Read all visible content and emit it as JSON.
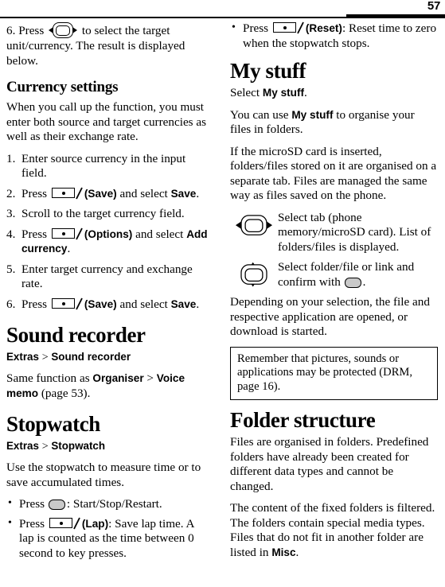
{
  "header": {
    "page_number": "57"
  },
  "left_column": {
    "continued_step": {
      "number": "6.",
      "text_before": "Press",
      "icon": "nav-key-left-right-icon",
      "text_after": "to select the target unit/currency. The result is displayed below."
    },
    "currency_settings": {
      "heading": "Currency settings",
      "intro": "When you call up the function, you must enter both source and target currencies as well as their exchange rate.",
      "steps": [
        {
          "num": 1,
          "parts": [
            {
              "type": "text",
              "value": "Enter source currency in the input field."
            }
          ]
        },
        {
          "num": 2,
          "parts": [
            {
              "type": "text",
              "value": "Press "
            },
            {
              "type": "icon",
              "value": "softkey-icon"
            },
            {
              "type": "ui",
              "value": "(Save)"
            },
            {
              "type": "text",
              "value": " and select "
            },
            {
              "type": "ui",
              "value": "Save"
            },
            {
              "type": "text",
              "value": "."
            }
          ]
        },
        {
          "num": 3,
          "parts": [
            {
              "type": "text",
              "value": "Scroll to the target currency field."
            }
          ]
        },
        {
          "num": 4,
          "parts": [
            {
              "type": "text",
              "value": "Press "
            },
            {
              "type": "icon",
              "value": "softkey-icon"
            },
            {
              "type": "ui",
              "value": "(Options)"
            },
            {
              "type": "text",
              "value": " and select "
            },
            {
              "type": "ui",
              "value": "Add currency"
            },
            {
              "type": "text",
              "value": "."
            }
          ]
        },
        {
          "num": 5,
          "parts": [
            {
              "type": "text",
              "value": "Enter target currency and exchange rate."
            }
          ]
        },
        {
          "num": 6,
          "parts": [
            {
              "type": "text",
              "value": "Press "
            },
            {
              "type": "icon",
              "value": "softkey-icon"
            },
            {
              "type": "ui",
              "value": "(Save)"
            },
            {
              "type": "text",
              "value": " and select "
            },
            {
              "type": "ui",
              "value": "Save"
            },
            {
              "type": "text",
              "value": "."
            }
          ]
        }
      ]
    },
    "sound_recorder": {
      "heading": "Sound recorder",
      "breadcrumb": {
        "first": "Extras",
        "sep": ">",
        "second": "Sound recorder"
      },
      "body_1": "Same function as ",
      "body_ui_1": "Organiser",
      "body_sep": " > ",
      "body_ui_2": "Voice memo",
      "body_2": " (page 53)."
    },
    "stopwatch": {
      "heading": "Stopwatch",
      "breadcrumb": {
        "first": "Extras",
        "sep": ">",
        "second": "Stopwatch"
      },
      "intro": "Use the stopwatch to measure time or to save accumulated times.",
      "bullets": [
        {
          "parts": [
            {
              "type": "text",
              "value": "Press "
            },
            {
              "type": "icon",
              "value": "ok-key-icon"
            },
            {
              "type": "text",
              "value": ": Start/Stop/Restart."
            }
          ]
        },
        {
          "parts": [
            {
              "type": "text",
              "value": "Press "
            },
            {
              "type": "icon",
              "value": "softkey-icon"
            },
            {
              "type": "ui",
              "value": "(Lap)"
            },
            {
              "type": "text",
              "value": ": Save lap time. A lap is counted as the time between 0 second to key presses."
            }
          ]
        }
      ]
    }
  },
  "right_column": {
    "stopwatch_continued": {
      "bullet": {
        "parts": [
          {
            "type": "text",
            "value": "Press "
          },
          {
            "type": "icon",
            "value": "softkey-icon"
          },
          {
            "type": "ui",
            "value": "(Reset)"
          },
          {
            "type": "text",
            "value": ": Reset time to zero when the stopwatch stops."
          }
        ]
      }
    },
    "my_stuff": {
      "heading": "My stuff",
      "select_prefix": "Select ",
      "select_ui": "My stuff",
      "select_suffix": ".",
      "para_1_prefix": "You can use ",
      "para_1_ui": "My stuff",
      "para_1_suffix": " to organise your files in folders.",
      "para_2": "If the microSD card is inserted, folders/files stored on it are organised on a separate tab. Files are managed the same way as files saved on the phone.",
      "icon_rows": [
        {
          "icon": "nav-key-left-right-icon",
          "desc": "Select tab (phone memory/microSD card). List of folders/files is displayed."
        },
        {
          "icon": "nav-key-up-down-icon",
          "desc_before": "Select folder/file or link and confirm with ",
          "desc_icon": "ok-key-icon",
          "desc_after": "."
        }
      ],
      "para_3": "Depending on your selection, the file and respective application are opened, or download is started.",
      "note": "Remember that pictures, sounds or applications may be protected (DRM, page 16)."
    },
    "folder_structure": {
      "heading": "Folder structure",
      "para_1": "Files are organised in folders. Predefined folders have already been created for different data types and cannot be changed.",
      "para_2_prefix": "The content of the fixed folders is filtered. The folders contain special media types. Files that do not fit in another folder are listed in ",
      "para_2_ui": "Misc",
      "para_2_suffix": "."
    }
  }
}
